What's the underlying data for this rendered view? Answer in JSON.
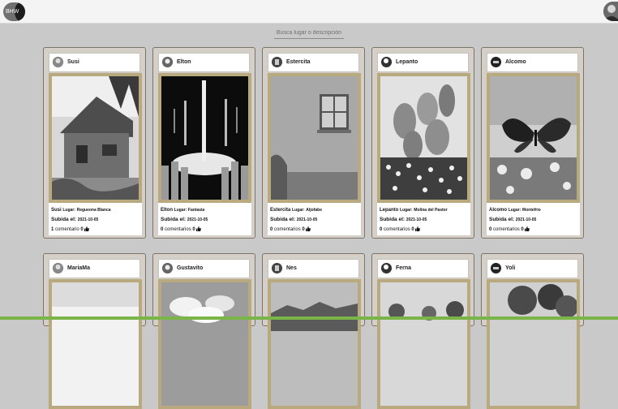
{
  "header": {
    "logo_text": "BHW",
    "search_placeholder": "Busca lugar o descripción"
  },
  "labels": {
    "place_prefix": "Lugar:",
    "uploaded_prefix": "Subida el:",
    "comments_word": "comentarios",
    "comment_singular": "comentario"
  },
  "cards": [
    {
      "user": "Susi",
      "place": "Regueona Blanca",
      "date": "2021-10-05",
      "comments": "1",
      "comments_label": "comentario",
      "likes": "0",
      "photo": "cabin"
    },
    {
      "user": "Elton",
      "place": "Fantasia",
      "date": "2021-10-05",
      "comments": "0",
      "comments_label": "comentarios",
      "likes": "0",
      "photo": "lights"
    },
    {
      "user": "Estercita",
      "place": "Aljofabe",
      "date": "2021-10-05",
      "comments": "0",
      "comments_label": "comentarios",
      "likes": "0",
      "photo": "window"
    },
    {
      "user": "Lepanto",
      "place": "Molina del Pastor",
      "date": "2021-10-05",
      "comments": "0",
      "comments_label": "comentarios",
      "likes": "0",
      "photo": "cactus"
    },
    {
      "user": "Alcomo",
      "place": "Montefrio",
      "date": "2021-10-05",
      "comments": "0",
      "comments_label": "comentarios",
      "likes": "0",
      "photo": "butterfly"
    },
    {
      "user": "MariaMa",
      "photo": "bright"
    },
    {
      "user": "Gustavito",
      "photo": "clouds"
    },
    {
      "user": "Nes",
      "photo": "mountains"
    },
    {
      "user": "Ferna",
      "photo": "trees"
    },
    {
      "user": "Yoli",
      "photo": "forest"
    }
  ]
}
